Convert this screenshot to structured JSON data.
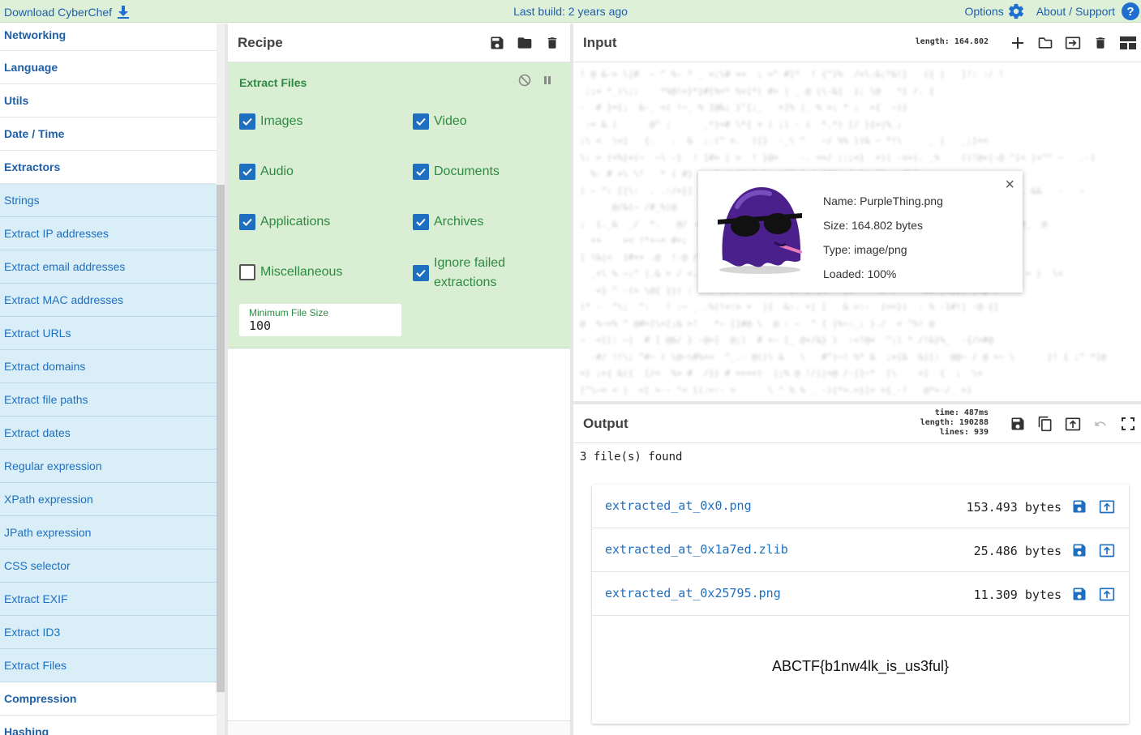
{
  "banner": {
    "download": "Download CyberChef",
    "build": "Last build: 2 years ago",
    "options": "Options",
    "about": "About / Support"
  },
  "ops": {
    "categories_top": [
      "Networking",
      "Language",
      "Utils",
      "Date / Time",
      "Extractors"
    ],
    "operations": [
      "Strings",
      "Extract IP addresses",
      "Extract email addresses",
      "Extract MAC addresses",
      "Extract URLs",
      "Extract domains",
      "Extract file paths",
      "Extract dates",
      "Regular expression",
      "XPath expression",
      "JPath expression",
      "CSS selector",
      "Extract EXIF",
      "Extract ID3",
      "Extract Files"
    ],
    "categories_bottom": [
      "Compression",
      "Hashing"
    ]
  },
  "recipe": {
    "title": "Recipe",
    "ingredient": {
      "name": "Extract Files",
      "options": [
        {
          "label": "Images",
          "checked": true
        },
        {
          "label": "Video",
          "checked": true
        },
        {
          "label": "Audio",
          "checked": true
        },
        {
          "label": "Documents",
          "checked": true
        },
        {
          "label": "Applications",
          "checked": true
        },
        {
          "label": "Archives",
          "checked": true
        },
        {
          "label": "Miscellaneous",
          "checked": false
        },
        {
          "label": "Ignore failed extractions",
          "checked": true
        }
      ],
      "min_size_label": "Minimum File Size",
      "min_size_value": "100"
    }
  },
  "input": {
    "title": "Input",
    "length_label": "length:",
    "length_value": "164.802"
  },
  "file_popup": {
    "name": "Name: PurpleThing.png",
    "size": "Size: 164.802 bytes",
    "type": "Type: image/png",
    "loaded": "Loaded: 100%",
    "close": "×"
  },
  "output": {
    "title": "Output",
    "time": "487ms",
    "length": "190288",
    "lines": "939",
    "time_label": "time:",
    "length_label": "length:",
    "lines_label": "lines:",
    "found": "3 file(s) found",
    "files": [
      {
        "name": "extracted_at_0x0.png",
        "size": "153.493 bytes"
      },
      {
        "name": "extracted_at_0x1a7ed.zlib",
        "size": "25.486 bytes"
      },
      {
        "name": "extracted_at_0x25795.png",
        "size": "11.309 bytes"
      }
    ],
    "flag": "ABCTF{b1nw4lk_is_us3ful}"
  },
  "colors": {
    "banner": "#dff0d8",
    "ingredient": "#daeed4",
    "op_bg": "#d9eef7",
    "link": "#1f6fbf",
    "checkbox": "#1e6fc0"
  }
}
